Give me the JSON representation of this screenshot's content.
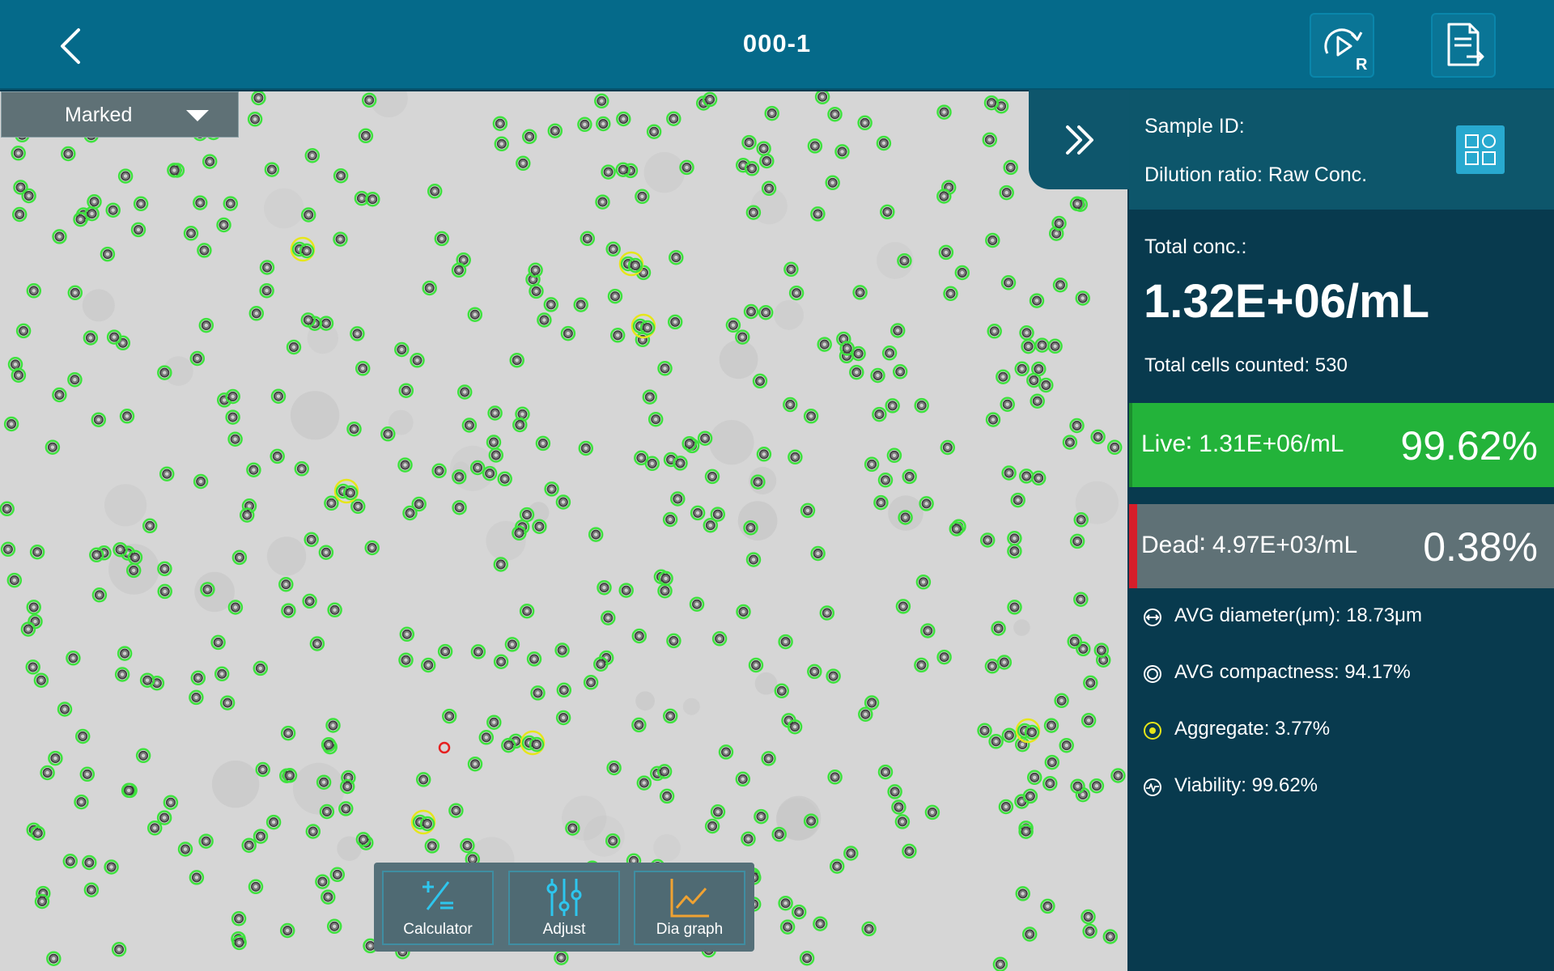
{
  "header": {
    "title": "000-1",
    "replay_badge": "R"
  },
  "image": {
    "mode_selected": "Marked"
  },
  "toolbar": {
    "calculator": "Calculator",
    "adjust": "Adjust",
    "dia_graph": "Dia graph"
  },
  "panel": {
    "sample_id": "Sample ID:",
    "dilution": "Dilution ratio: Raw Conc.",
    "total_label": "Total conc.:",
    "total_value": "1.32E+06/mL",
    "cells_counted": "Total cells counted: 530",
    "live_label": "Live∶  1.31E+06/mL",
    "live_pct": "99.62%",
    "dead_label": "Dead∶  4.97E+03/mL",
    "dead_pct": "0.38%",
    "avg_diameter": "AVG diameter(μm):  18.73μm",
    "avg_compactness": "AVG compactness:  94.17%",
    "aggregate": "Aggregate:  3.77%",
    "viability": "Viability:  99.62%"
  },
  "colors": {
    "header": "#056a8a",
    "panel": "#083a4e",
    "live": "#23b33a",
    "dead_marker": "#d61e2a",
    "cell_ring_live": "#3ee23e",
    "cell_ring_aggregate": "#e6e61a",
    "cell_ring_dead": "#e62020"
  }
}
